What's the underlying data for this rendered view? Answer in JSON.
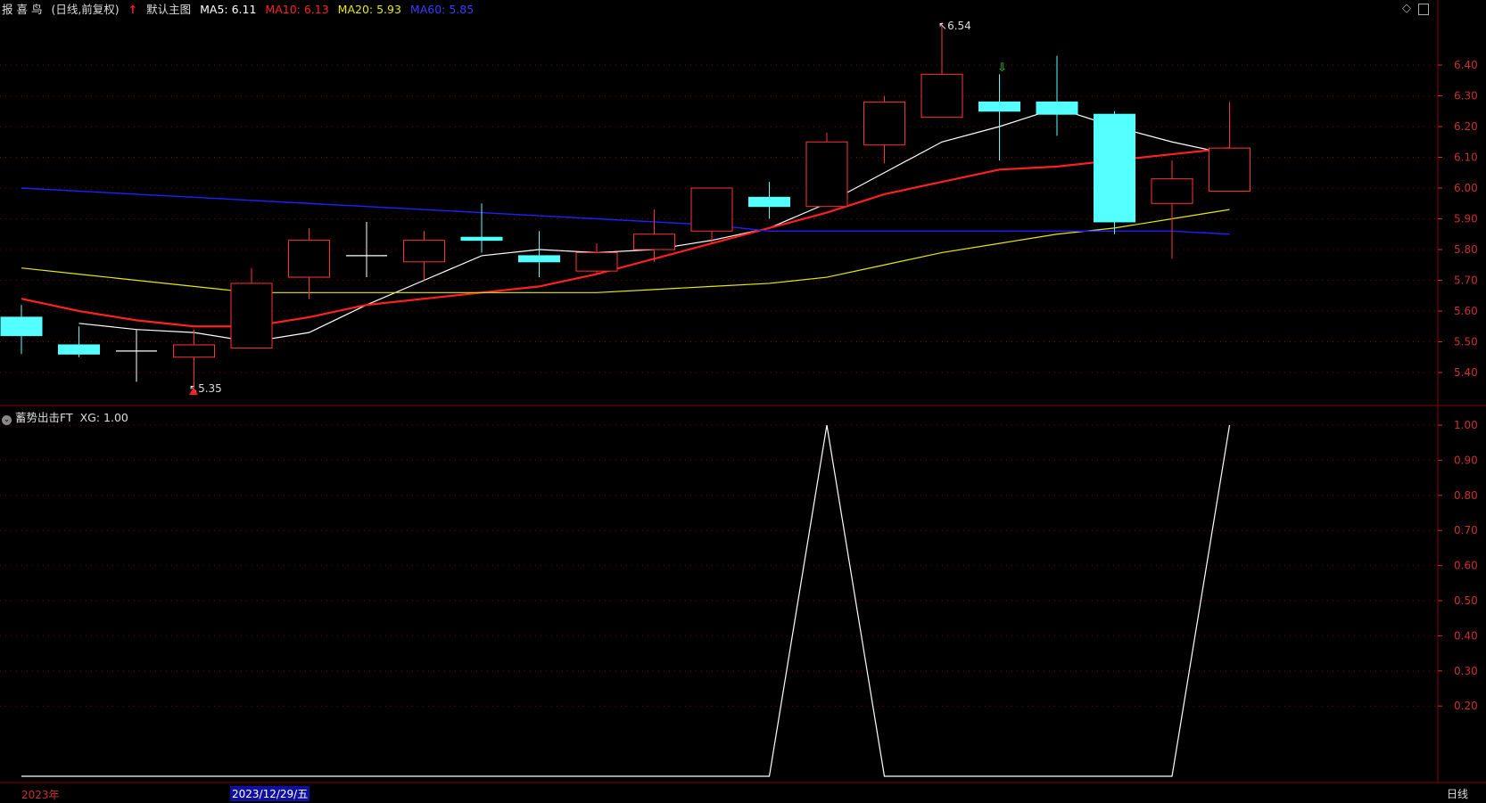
{
  "header": {
    "stock_name": "报 喜 鸟",
    "period": "(日线,前复权)",
    "indicator_main": "默认主图",
    "ma5": "MA5: 6.11",
    "ma10": "MA10: 6.13",
    "ma20": "MA20: 5.93",
    "ma60": "MA60: 5.85"
  },
  "sub_header": {
    "indicator_name": "蓄势出击FT",
    "xg": "XG: 1.00"
  },
  "annotations": {
    "high_label": "6.54",
    "low_label": "5.35"
  },
  "bottom": {
    "year_label": "2023年",
    "date_label": "2023/12/29/五",
    "period_button": "日线"
  },
  "colors": {
    "background": "#000000",
    "up": "#ff3232",
    "down": "#54ffff",
    "ma5": "#ffffff",
    "ma10": "#ff2020",
    "ma20": "#e8e800",
    "ma60": "#2020ff",
    "grid": "#7a0000",
    "axis_text": "#c83030"
  },
  "chart_data": [
    {
      "type": "candlestick",
      "title": "",
      "y_ticks": [
        "6.40",
        "6.30",
        "6.20",
        "6.10",
        "6.00",
        "5.90",
        "5.80",
        "5.70",
        "5.60",
        "5.50",
        "5.40"
      ],
      "ylim": [
        5.31,
        6.55
      ],
      "candles": [
        {
          "o": 5.58,
          "h": 5.62,
          "l": 5.46,
          "c": 5.52
        },
        {
          "o": 5.49,
          "h": 5.55,
          "l": 5.45,
          "c": 5.46
        },
        {
          "o": 5.47,
          "h": 5.54,
          "l": 5.37,
          "c": 5.47
        },
        {
          "o": 5.45,
          "h": 5.54,
          "l": 5.35,
          "c": 5.49
        },
        {
          "o": 5.48,
          "h": 5.74,
          "l": 5.48,
          "c": 5.69
        },
        {
          "o": 5.71,
          "h": 5.87,
          "l": 5.64,
          "c": 5.83
        },
        {
          "o": 5.78,
          "h": 5.89,
          "l": 5.71,
          "c": 5.78
        },
        {
          "o": 5.76,
          "h": 5.86,
          "l": 5.7,
          "c": 5.83
        },
        {
          "o": 5.84,
          "h": 5.95,
          "l": 5.79,
          "c": 5.83
        },
        {
          "o": 5.78,
          "h": 5.86,
          "l": 5.71,
          "c": 5.76
        },
        {
          "o": 5.73,
          "h": 5.82,
          "l": 5.72,
          "c": 5.79
        },
        {
          "o": 5.8,
          "h": 5.93,
          "l": 5.76,
          "c": 5.85
        },
        {
          "o": 5.86,
          "h": 6.0,
          "l": 5.82,
          "c": 6.0
        },
        {
          "o": 5.97,
          "h": 6.02,
          "l": 5.9,
          "c": 5.94
        },
        {
          "o": 5.94,
          "h": 6.18,
          "l": 5.94,
          "c": 6.15
        },
        {
          "o": 6.14,
          "h": 6.3,
          "l": 6.08,
          "c": 6.28
        },
        {
          "o": 6.23,
          "h": 6.54,
          "l": 6.23,
          "c": 6.37
        },
        {
          "o": 6.28,
          "h": 6.37,
          "l": 6.09,
          "c": 6.25
        },
        {
          "o": 6.28,
          "h": 6.43,
          "l": 6.17,
          "c": 6.24
        },
        {
          "o": 6.24,
          "h": 6.25,
          "l": 5.85,
          "c": 5.89
        },
        {
          "o": 5.95,
          "h": 6.09,
          "l": 5.77,
          "c": 6.03
        },
        {
          "o": 5.99,
          "h": 6.28,
          "l": 5.99,
          "c": 6.13
        }
      ],
      "series": [
        {
          "name": "MA5",
          "values": [
            5.56,
            5.54,
            5.53,
            5.5,
            5.53,
            5.62,
            5.7,
            5.78,
            5.8,
            5.79,
            5.8,
            5.83,
            5.87,
            5.95,
            6.05,
            6.15,
            6.2,
            6.26,
            6.2,
            6.15,
            6.11
          ]
        },
        {
          "name": "MA10",
          "values": [
            5.64,
            5.6,
            5.57,
            5.55,
            5.55,
            5.58,
            5.62,
            5.64,
            5.66,
            5.68,
            5.72,
            5.77,
            5.82,
            5.87,
            5.92,
            5.98,
            6.02,
            6.06,
            6.07,
            6.09,
            6.11,
            6.13
          ]
        },
        {
          "name": "MA20",
          "values": [
            5.74,
            5.72,
            5.7,
            5.68,
            5.66,
            5.66,
            5.66,
            5.66,
            5.66,
            5.66,
            5.66,
            5.67,
            5.68,
            5.69,
            5.71,
            5.75,
            5.79,
            5.82,
            5.85,
            5.87,
            5.9,
            5.93
          ]
        },
        {
          "name": "MA60",
          "values": [
            6.0,
            5.99,
            5.98,
            5.97,
            5.96,
            5.95,
            5.94,
            5.93,
            5.92,
            5.91,
            5.9,
            5.89,
            5.88,
            5.86,
            5.86,
            5.86,
            5.86,
            5.86,
            5.86,
            5.86,
            5.86,
            5.85
          ]
        }
      ]
    },
    {
      "type": "line",
      "title": "",
      "y_ticks": [
        "1.00",
        "0.90",
        "0.80",
        "0.70",
        "0.60",
        "0.50",
        "0.40",
        "0.30",
        "0.20"
      ],
      "ylim": [
        0,
        1
      ],
      "series": [
        {
          "name": "XG",
          "values": [
            0,
            0,
            0,
            0,
            0,
            0,
            0,
            0,
            0,
            0,
            0,
            0,
            0,
            0,
            1,
            0,
            0,
            0,
            0,
            0,
            0,
            1
          ]
        }
      ]
    }
  ]
}
